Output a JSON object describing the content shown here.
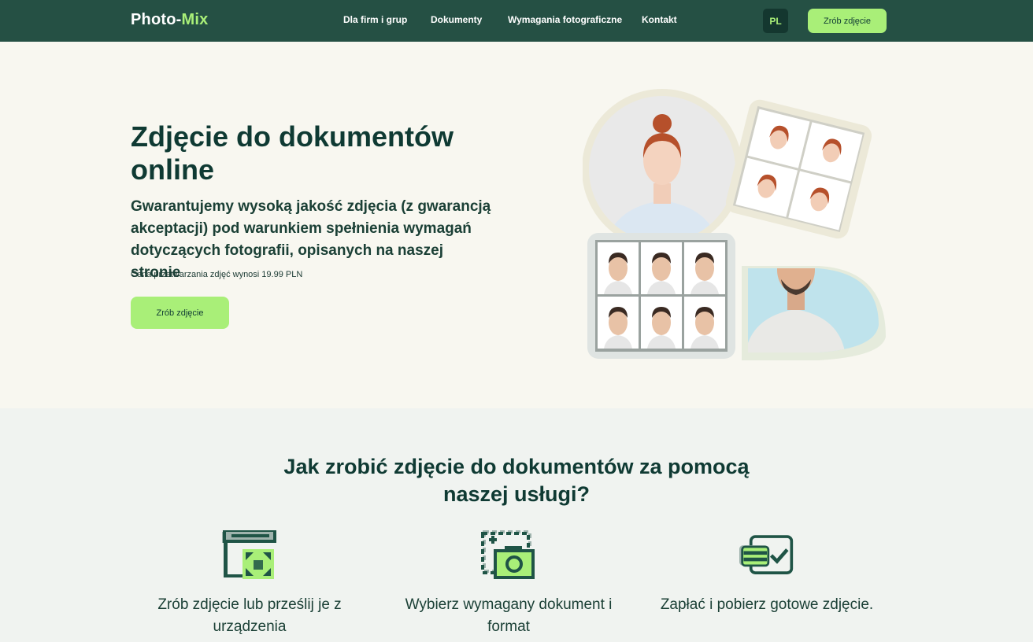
{
  "header": {
    "logo_text": "Photo-",
    "logo_accent": "Mix",
    "nav": [
      "Dla firm i grup",
      "Dokumenty",
      "Wymagania fotograficzne",
      "Kontakt"
    ],
    "language": "PL",
    "cta_label": "Zrób zdjęcie"
  },
  "hero": {
    "title": "Zdjęcie do dokumentów online",
    "lead": "Gwarantujemy wysoką jakość zdjęcia (z gwarancją akceptacji) pod warunkiem spełnienia wymagań dotyczących fotografii, opisanych na naszej stronie",
    "price_note": "Cena przetwarzania zdjęć wynosi 19.99 PLN",
    "cta_label": "Zrób zdjęcie"
  },
  "how": {
    "title": "Jak zrobić zdjęcie do dokumentów za pomocą naszej usługi?",
    "steps": [
      {
        "label": "Zrób zdjęcie lub prześlij je z urządzenia",
        "icon": "browser-expand-icon"
      },
      {
        "label": "Wybierz wymagany dokument i format",
        "icon": "camera-crop-icon"
      },
      {
        "label": "Zapłać i pobierz gotowe zdjęcie.",
        "icon": "card-check-icon"
      }
    ]
  },
  "colors": {
    "header_bg": "#255044",
    "accent": "#a9ef78",
    "hero_bg": "#f8f7f0",
    "steps_bg": "#f0f3f0",
    "text_dark": "#0f3a33"
  }
}
